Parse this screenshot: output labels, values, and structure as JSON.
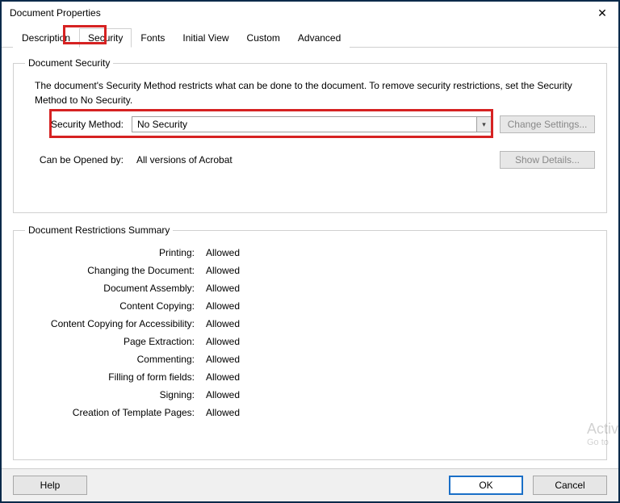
{
  "window": {
    "title": "Document Properties"
  },
  "tabs": {
    "items": [
      "Description",
      "Security",
      "Fonts",
      "Initial View",
      "Custom",
      "Advanced"
    ],
    "active_index": 1
  },
  "security_group": {
    "legend": "Document Security",
    "info": "The document's Security Method restricts what can be done to the document. To remove security restrictions, set the Security Method to No Security.",
    "method_label": "Security Method:",
    "method_value": "No Security",
    "change_btn": "Change Settings...",
    "opened_by_label": "Can be Opened by:",
    "opened_by_value": "All versions of Acrobat",
    "details_btn": "Show Details..."
  },
  "restrictions": {
    "legend": "Document Restrictions Summary",
    "rows": [
      {
        "label": "Printing:",
        "value": "Allowed"
      },
      {
        "label": "Changing the Document:",
        "value": "Allowed"
      },
      {
        "label": "Document Assembly:",
        "value": "Allowed"
      },
      {
        "label": "Content Copying:",
        "value": "Allowed"
      },
      {
        "label": "Content Copying for Accessibility:",
        "value": "Allowed"
      },
      {
        "label": "Page Extraction:",
        "value": "Allowed"
      },
      {
        "label": "Commenting:",
        "value": "Allowed"
      },
      {
        "label": "Filling of form fields:",
        "value": "Allowed"
      },
      {
        "label": "Signing:",
        "value": "Allowed"
      },
      {
        "label": "Creation of Template Pages:",
        "value": "Allowed"
      }
    ]
  },
  "buttons": {
    "help": "Help",
    "ok": "OK",
    "cancel": "Cancel"
  },
  "watermark": {
    "line1": "Activ",
    "line2": "Go to"
  },
  "highlight_color": "#d62222"
}
